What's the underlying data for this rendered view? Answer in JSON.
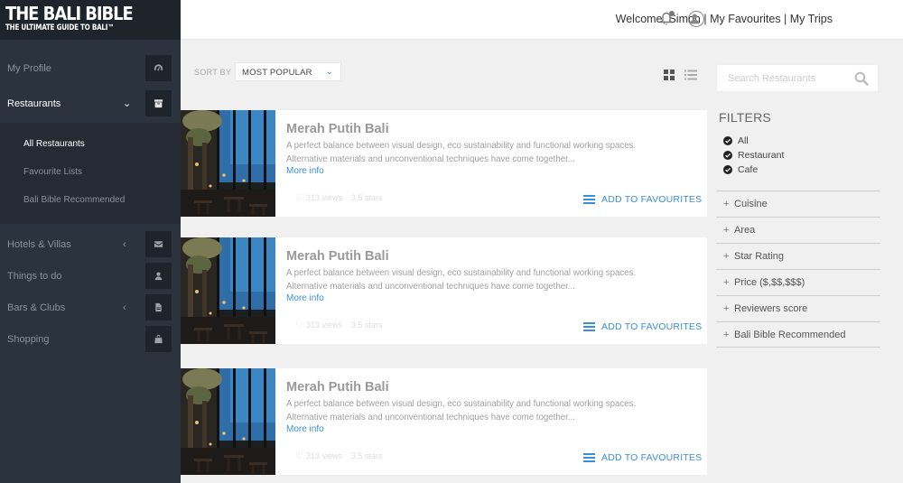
{
  "brand": {
    "title": "THE BALI BIBLE",
    "tagline": "THE ULTIMATE GUIDE TO BALI™"
  },
  "header": {
    "links": "Welcome, Simon | My Favourites | My Trips"
  },
  "sidebar": {
    "items": [
      {
        "label": "My Profile",
        "icon": "dashboard-icon"
      },
      {
        "label": "Restaurants",
        "icon": "archive-icon",
        "active": true,
        "expanded": true
      },
      {
        "label": "Hotels & Villas",
        "icon": "envelope-icon"
      },
      {
        "label": "Things to do",
        "icon": "user-icon"
      },
      {
        "label": "Bars & Clubs",
        "icon": "file-icon"
      },
      {
        "label": "Shopping",
        "icon": "bag-icon"
      }
    ],
    "submenu": [
      {
        "label": "All Restaurants",
        "active": true
      },
      {
        "label": "Favourite Lists"
      },
      {
        "label": "Bali Bible Recommended"
      }
    ]
  },
  "sort": {
    "label": "SORT BY",
    "value": "MOST POPULAR"
  },
  "cards": [
    {
      "title": "Merah Putih Bali",
      "desc1": "A perfect balance between visual design, eco sustainability and functional working spaces.",
      "desc2": "Alternative materials and unconventional techniques have come together...",
      "more": "More info",
      "views": "313 views",
      "stars": "3.5 stars",
      "fav": "ADD TO FAVOURITES"
    },
    {
      "title": "Merah Putih Bali",
      "desc1": "A perfect balance between visual design, eco sustainability and functional working spaces.",
      "desc2": "Alternative materials and unconventional techniques have come together...",
      "more": "More info",
      "views": "313 views",
      "stars": "3.5 stars",
      "fav": "ADD TO FAVOURITES"
    },
    {
      "title": "Merah Putih Bali",
      "desc1": "A perfect balance between visual design, eco sustainability and functional working spaces.",
      "desc2": "Alternative materials and unconventional techniques have come together...",
      "more": "More info",
      "views": "313 views",
      "stars": "3.5 stars",
      "fav": "ADD TO FAVOURITES"
    }
  ],
  "search": {
    "placeholder": "Search Restaurants"
  },
  "filters": {
    "title": "FILTERS",
    "types": [
      {
        "label": "All",
        "checked": true
      },
      {
        "label": "Restaurant",
        "checked": true
      },
      {
        "label": "Cafe",
        "checked": true
      }
    ],
    "sections": [
      "Cuisine",
      "Area",
      "Star Rating",
      "Price ($,$$,$$$)",
      "Reviewers score",
      "Bali Bible Recommended"
    ]
  },
  "colors": {
    "sidebar": "#2b333e",
    "accent": "#3b8fd6"
  }
}
